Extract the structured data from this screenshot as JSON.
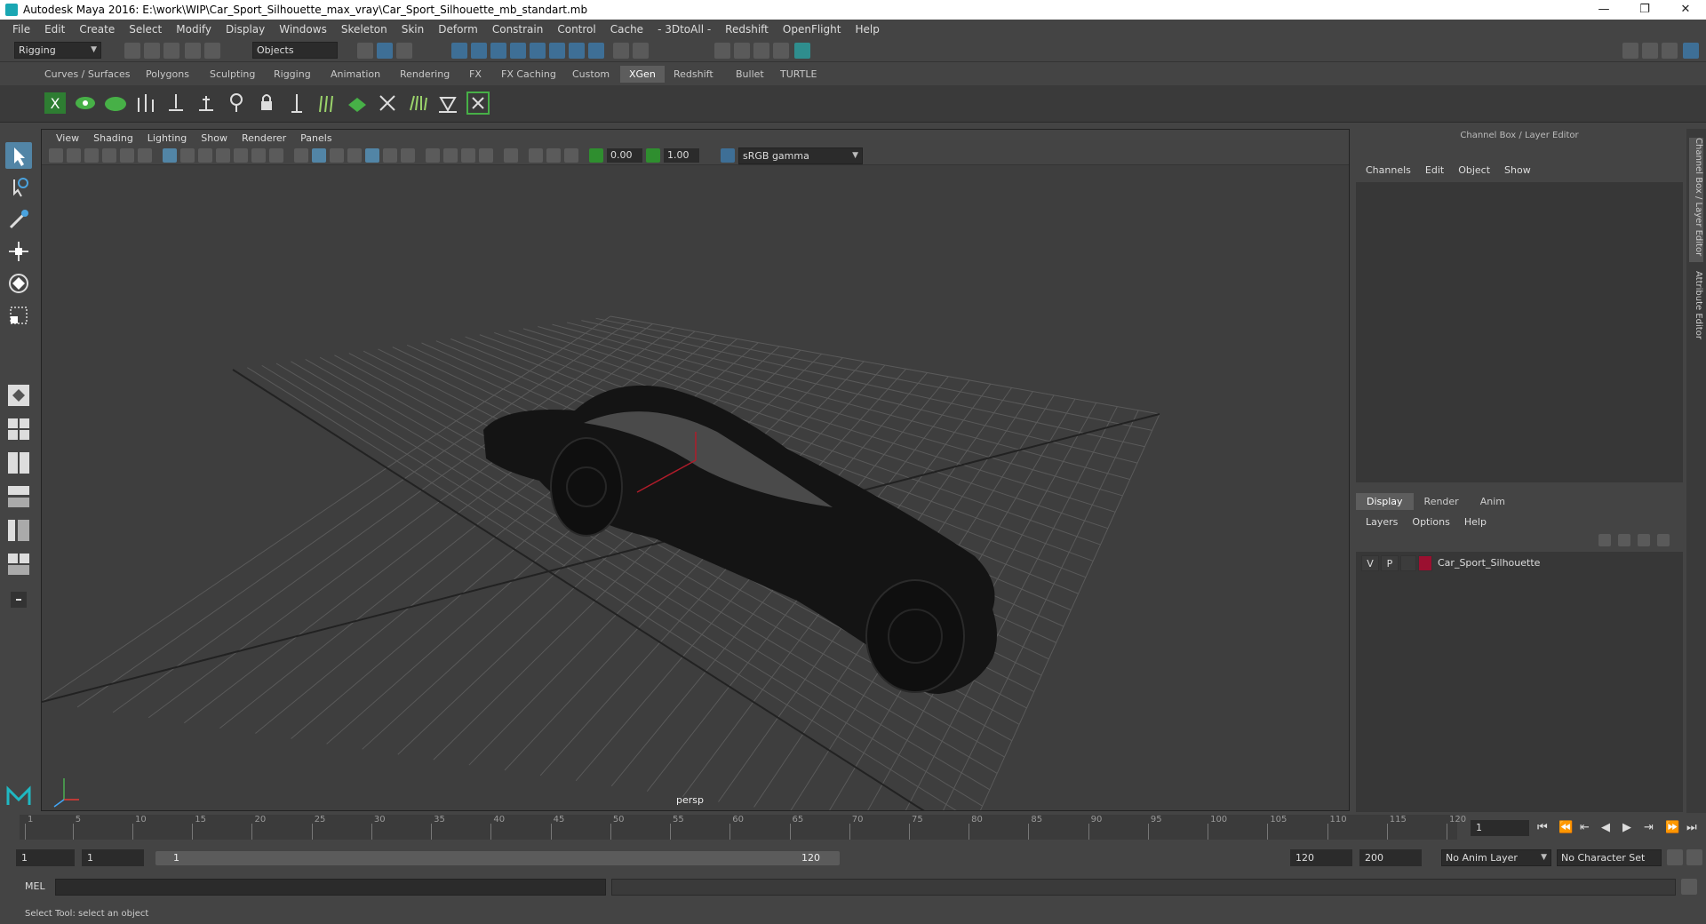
{
  "window": {
    "title": "Autodesk Maya 2016: E:\\work\\WIP\\Car_Sport_Silhouette_max_vray\\Car_Sport_Silhouette_mb_standart.mb",
    "minimize": "—",
    "restore": "❐",
    "close": "✕"
  },
  "menubar": [
    "File",
    "Edit",
    "Create",
    "Select",
    "Modify",
    "Display",
    "Windows",
    "Skeleton",
    "Skin",
    "Deform",
    "Constrain",
    "Control",
    "Cache",
    "- 3DtoAll -",
    "Redshift",
    "OpenFlight",
    "Help"
  ],
  "statusline": {
    "menuset": "Rigging",
    "selection_mode": "Objects"
  },
  "shelf": {
    "tabs": [
      "Curves / Surfaces",
      "Polygons",
      "Sculpting",
      "Rigging",
      "Animation",
      "Rendering",
      "FX",
      "FX Caching",
      "Custom",
      "XGen",
      "Redshift",
      "Bullet",
      "TURTLE"
    ],
    "active_tab": "XGen"
  },
  "viewport": {
    "menu": [
      "View",
      "Shading",
      "Lighting",
      "Show",
      "Renderer",
      "Panels"
    ],
    "exposure": "0.00",
    "gamma": "1.00",
    "color_space": "sRGB gamma",
    "camera": "persp"
  },
  "channelbox": {
    "title": "Channel Box / Layer Editor",
    "menu": [
      "Channels",
      "Edit",
      "Object",
      "Show"
    ],
    "layer_tabs": [
      "Display",
      "Render",
      "Anim"
    ],
    "active_layer_tab": "Display",
    "layer_menu": [
      "Layers",
      "Options",
      "Help"
    ],
    "layer": {
      "visible": "V",
      "playback": "P",
      "name": "Car_Sport_Silhouette",
      "color": "#9b1030"
    }
  },
  "dock_tabs": [
    "Channel Box / Layer Editor",
    "Attribute Editor"
  ],
  "timeslider": {
    "ticks": [
      "1",
      "5",
      "10",
      "15",
      "20",
      "25",
      "30",
      "35",
      "40",
      "45",
      "50",
      "55",
      "60",
      "65",
      "70",
      "75",
      "80",
      "85",
      "90",
      "95",
      "100",
      "105",
      "110",
      "115",
      "120"
    ],
    "current_frame": "1"
  },
  "rangeslider": {
    "start": "1",
    "playback_start": "1",
    "range_start": "1",
    "range_end": "120",
    "playback_end": "120",
    "end": "200",
    "anim_layer": "No Anim Layer",
    "character_set": "No Character Set"
  },
  "cmdline": {
    "label": "MEL"
  },
  "helpline": {
    "text": "Select Tool: select an object"
  },
  "colors": {
    "accent": "#5285a6",
    "background": "#444444",
    "viewport": "#3d3d3d"
  }
}
